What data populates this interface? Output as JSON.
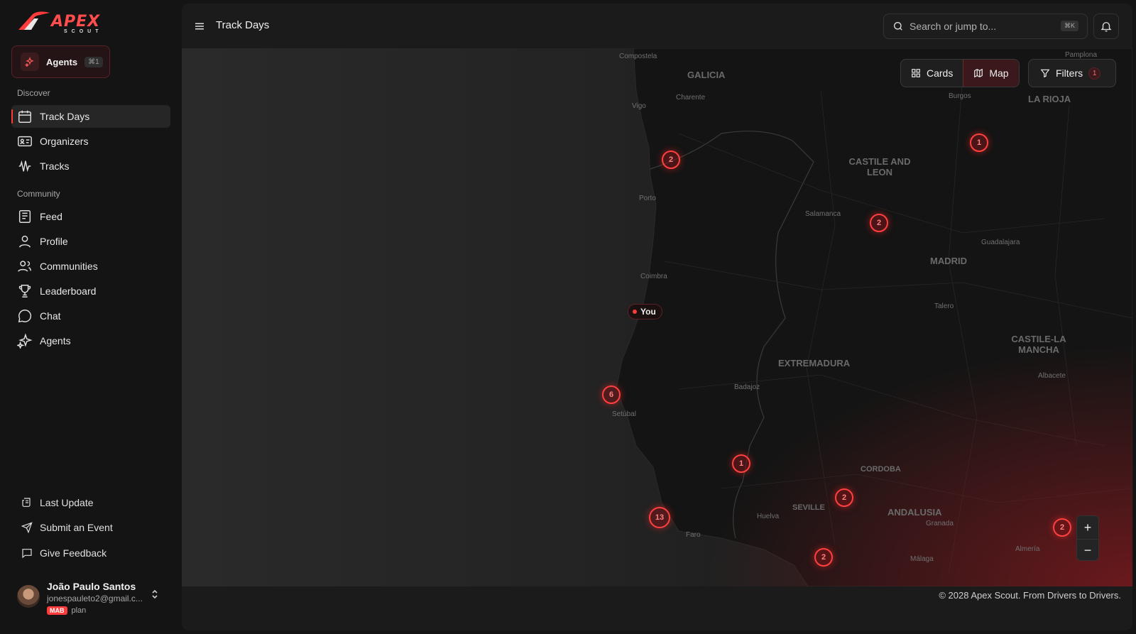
{
  "brand": {
    "name": "APEX",
    "sub": "SCOUT"
  },
  "agents_pill": {
    "label": "Agents",
    "shortcut": "⌘1"
  },
  "sidebar": {
    "discover_label": "Discover",
    "discover_items": [
      {
        "label": "Track Days",
        "icon": "calendar-icon",
        "active": true
      },
      {
        "label": "Organizers",
        "icon": "id-card-icon"
      },
      {
        "label": "Tracks",
        "icon": "waveform-icon"
      }
    ],
    "community_label": "Community",
    "community_items": [
      {
        "label": "Feed",
        "icon": "newspaper-icon"
      },
      {
        "label": "Profile",
        "icon": "user-icon"
      },
      {
        "label": "Communities",
        "icon": "users-icon"
      },
      {
        "label": "Leaderboard",
        "icon": "trophy-icon"
      },
      {
        "label": "Chat",
        "icon": "chat-bubble-icon"
      },
      {
        "label": "Agents",
        "icon": "sparkles-icon"
      }
    ],
    "footer_items": [
      {
        "label": "Last Update",
        "icon": "scroll-icon"
      },
      {
        "label": "Submit an Event",
        "icon": "send-icon"
      },
      {
        "label": "Give Feedback",
        "icon": "message-square-icon"
      }
    ]
  },
  "user": {
    "name": "João Paulo Santos",
    "email": "jonespauleto2@gmail.c...",
    "plan_badge": "MAB",
    "plan_label": "plan"
  },
  "header": {
    "title": "Track Days",
    "search_placeholder": "Search or jump to...",
    "search_shortcut": "⌘K"
  },
  "map_controls": {
    "cards_label": "Cards",
    "map_label": "Map",
    "filters_label": "Filters",
    "filters_count": "1"
  },
  "you_label": "You",
  "clusters": [
    "2",
    "1",
    "2",
    "6",
    "1",
    "13",
    "2",
    "2",
    "2"
  ],
  "regions": [
    "GALICIA",
    "CASTILE AND LEON",
    "MADRID",
    "EXTREMADURA",
    "CASTILE-LA MANCHA",
    "ANDALUSIA",
    "CORDOBA",
    "SEVILLE",
    "LA RIOJA"
  ],
  "places": [
    "Compostela",
    "Charente",
    "Vigo",
    "Porto",
    "Salamanca",
    "Guadalajara",
    "Talero",
    "Coimbra",
    "Badajoz",
    "Setúbal",
    "Albacete",
    "Huelva",
    "Faro",
    "Granada",
    "Málaga",
    "Almería",
    "Burgos",
    "Pamplona"
  ],
  "footer": "© 2028 Apex Scout. From Drivers to Drivers."
}
